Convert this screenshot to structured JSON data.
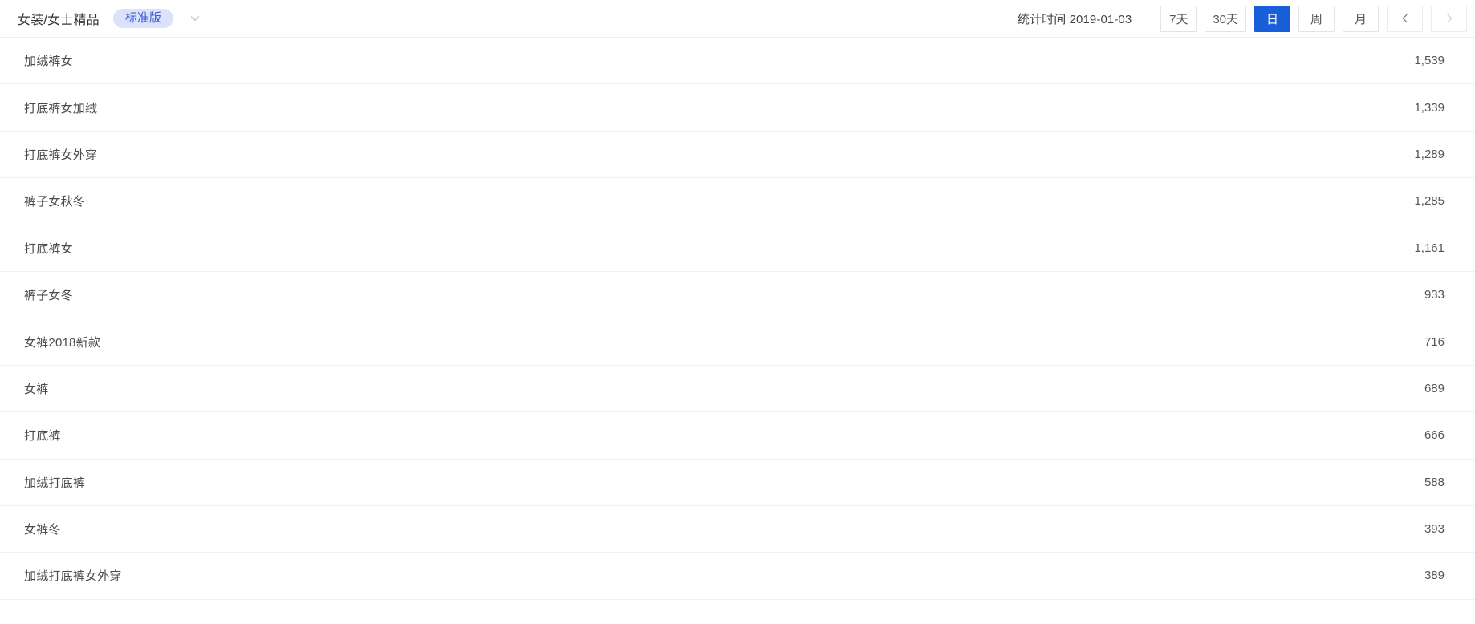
{
  "header": {
    "category_title": "女装/女士精品",
    "version_badge": "标准版",
    "dropdown_icon": "chevron-down-icon",
    "stat_time_label": "统计时间 2019-01-03",
    "range_buttons": [
      {
        "label": "7天",
        "active": false
      },
      {
        "label": "30天",
        "active": false
      },
      {
        "label": "日",
        "active": true
      },
      {
        "label": "周",
        "active": false
      },
      {
        "label": "月",
        "active": false
      }
    ],
    "nav": {
      "prev_icon": "chevron-left-icon",
      "next_icon": "chevron-right-icon",
      "prev_enabled": true,
      "next_enabled": false
    },
    "accent_color": "#1a5fd8",
    "badge_bg_color": "#dde2fb",
    "badge_text_color": "#3b5ed8"
  },
  "list": {
    "rows": [
      {
        "name": "加绒裤女",
        "value": "1,539"
      },
      {
        "name": "打底裤女加绒",
        "value": "1,339"
      },
      {
        "name": "打底裤女外穿",
        "value": "1,289"
      },
      {
        "name": "裤子女秋冬",
        "value": "1,285"
      },
      {
        "name": "打底裤女",
        "value": "1,161"
      },
      {
        "name": "裤子女冬",
        "value": "933"
      },
      {
        "name": "女裤2018新款",
        "value": "716"
      },
      {
        "name": "女裤",
        "value": "689"
      },
      {
        "name": "打底裤",
        "value": "666"
      },
      {
        "name": "加绒打底裤",
        "value": "588"
      },
      {
        "name": "女裤冬",
        "value": "393"
      },
      {
        "name": "加绒打底裤女外穿",
        "value": "389"
      }
    ]
  }
}
